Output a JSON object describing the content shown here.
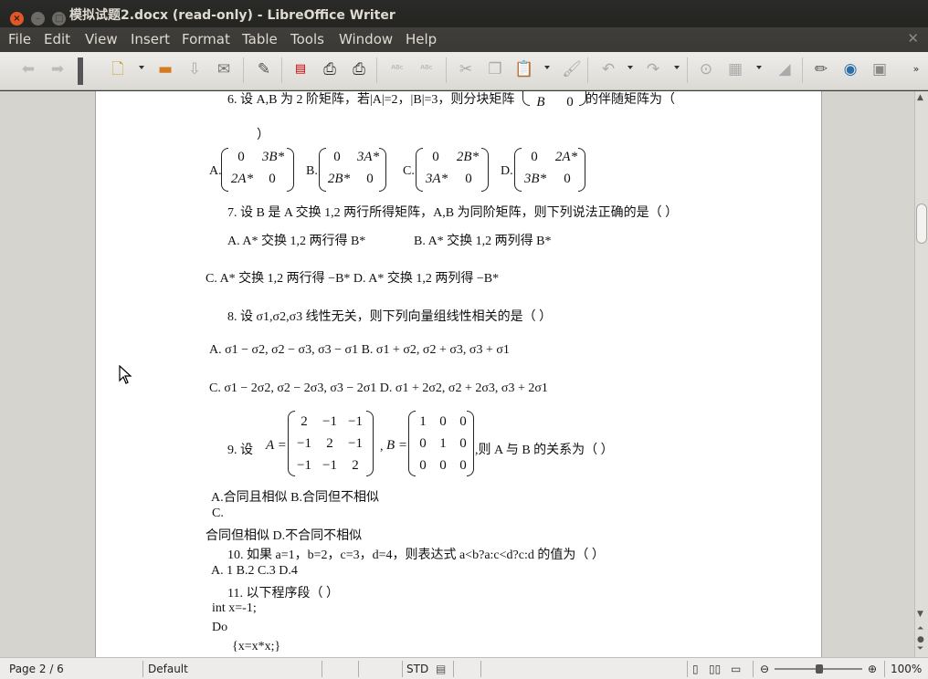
{
  "window": {
    "title": "模拟试题2.docx (read-only) - LibreOffice Writer"
  },
  "menu": [
    "File",
    "Edit",
    "View",
    "Insert",
    "Format",
    "Table",
    "Tools",
    "Window",
    "Help"
  ],
  "status": {
    "page": "Page 2 / 6",
    "style": "Default",
    "mode": "STD",
    "zoom": "100%"
  },
  "doc": {
    "q6_line": "6.   设 A,B 为 2 阶矩阵，若|A|=2，|B|=3，则分块矩阵",
    "q6_m_b": "B",
    "q6_m_0": "0",
    "q6_tail": "的伴随矩阵为（",
    "q6_close": "）",
    "q6_opt_a": "A.",
    "q6_opt_b": "B.",
    "q6_opt_c": "C.",
    "q6_opt_d": "D.",
    "ma": [
      "0",
      "3B*",
      "2A*",
      "0"
    ],
    "mb": [
      "0",
      "3A*",
      "2B*",
      "0"
    ],
    "mc": [
      "0",
      "2B*",
      "3A*",
      "0"
    ],
    "md": [
      "0",
      "2A*",
      "3B*",
      "0"
    ],
    "q7": "7.   设 B 是 A 交换 1,2 两行所得矩阵，A,B 为同阶矩阵，则下列说法正确的是（      ）",
    "q7_a": "A.   A* 交换 1,2 两行得 B*",
    "q7_b": "B.   A* 交换 1,2 两列得 B*",
    "q7_cd": "C.  A* 交换 1,2 两行得 −B*     D.  A* 交换 1,2 两列得 −B*",
    "q8": "8.   设 σ1,σ2,σ3 线性无关，则下列向量组线性相关的是（        ）",
    "q8_ab": "A.  σ1 − σ2, σ2 − σ3, σ3 − σ1       B.  σ1 + σ2, σ2 + σ3, σ3 + σ1",
    "q8_cd": "C. σ1 − 2σ2, σ2 − 2σ3, σ3 − 2σ1    D. σ1 + 2σ2, σ2 + 2σ3, σ3 + 2σ1",
    "q9_pre": "9.   设",
    "q9_a": "A =",
    "q9_comma": ",",
    "q9_b": "B =",
    "q9_tail": ",则 A 与 B 的关系为（        ）",
    "mA": [
      "2",
      "−1",
      "−1",
      "−1",
      "2",
      "−1",
      "−1",
      "−1",
      "2"
    ],
    "mB": [
      "1",
      "0",
      "0",
      "0",
      "1",
      "0",
      "0",
      "0",
      "0"
    ],
    "q9_ab": "A.合同且相似              B.合同但不相似",
    "q9_c": "C.",
    "q9_cd": "合同但相似          D.不合同不相似",
    "q10": "10.  如果 a=1，b=2，c=3，d=4，则表达式 a<b?a:c<d?c:d 的值为（        ）",
    "q10_opts": "A. 1       B.2       C.3       D.4",
    "q11": "11.  以下程序段（        ）",
    "code1": "int x=-1;",
    "code2": "Do",
    "code3": "{x=x*x;}"
  }
}
